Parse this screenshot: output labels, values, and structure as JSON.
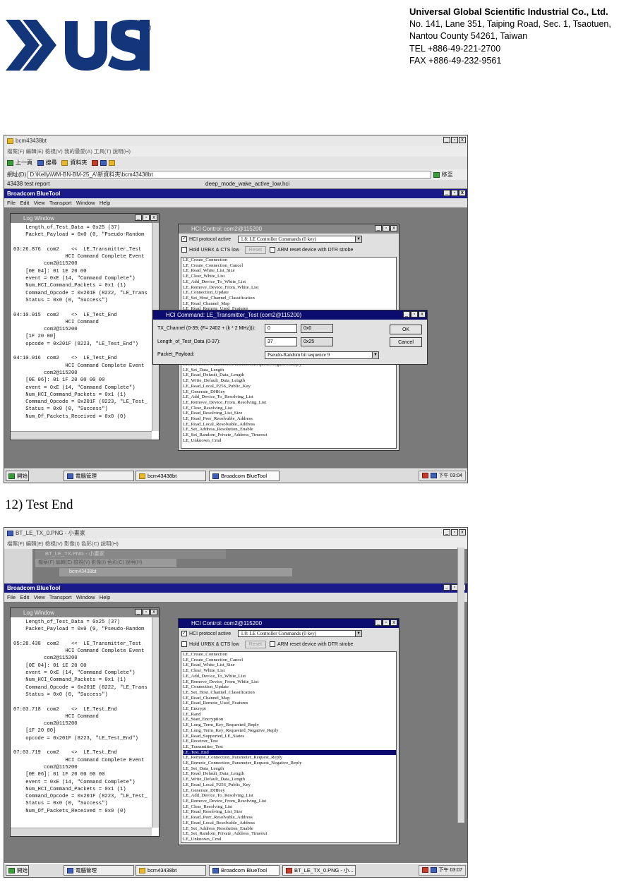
{
  "header": {
    "company_name": "Universal Global Scientific Industrial Co., Ltd.",
    "address_line1": "No. 141, Lane 351, Taiping Road, Sec. 1, Tsaotuen,",
    "address_line2": "Nantou County 54261, Taiwan",
    "tel": "TEL  +886-49-221-2700",
    "fax": "FAX +886-49-232-9561",
    "logo_text": "USI®"
  },
  "caption": "12) Test End",
  "shot1": {
    "explorer_title": "bcm43438bt",
    "explorer_menu": "檔案(F)   編輯(E)   檢視(V)   我的最愛(A)   工具(T)   說明(H)",
    "toolbar_back": "上一頁",
    "toolbar_search": "搜尋",
    "toolbar_folders": "資料夾",
    "address_label": "網址(D)",
    "address_value": "D:\\Kelly\\WM-BN-BM-25_A\\新資料夾\\bcm43438bt",
    "address_go": "移至",
    "tab_left": "43438 test report",
    "tab_right": "deep_mode_wake_active_low.hci",
    "app_title": "Broadcom BlueTool",
    "app_menu": [
      "File",
      "Edit",
      "View",
      "Transport",
      "Window",
      "Help"
    ],
    "log_title": "Log Window",
    "log_lines": [
      "    Length_of_Test_Data = 0x25 (37)",
      "    Packet_Payload = 0x0 (0, \"Pseudo-Random",
      "",
      "03:26.876  com2    <<  LE_Transmitter_Test",
      "                 HCI Command Complete Event",
      "          com2@115200",
      "    [0E 04]: 01 1E 20 00",
      "    event = 0xE (14, \"Command Complete\")",
      "    Num_HCI_Command_Packets = 0x1 (1)",
      "    Command_Opcode = 0x201E (8222, \"LE_Trans",
      "    Status = 0x0 (0, \"Success\")",
      "",
      "04:10.015  com2    <>  LE_Test_End",
      "                 HCI Command",
      "          com2@115200",
      "    [1F 20 00]",
      "    opcode = 0x201F (8223, \"LE_Test_End\")",
      "",
      "04:10.016  com2    <>  LE_Test_End",
      "                 HCI Command Complete Event",
      "          com2@115200",
      "    [0E 06]: 01 1F 20 00 00 00",
      "    event = 0xE (14, \"Command Complete\")",
      "    Num_HCI_Command_Packets = 0x1 (1)",
      "    Command_Opcode = 0x201F (8223, \"LE_Test_",
      "    Status = 0x0 (0, \"Success\")",
      "    Num_Of_Packets_Received = 0x0 (0)"
    ],
    "hci_title": "HCI Control: com2@115200",
    "hci_protocol_label": "HCI protocol active",
    "hci_combo": "1.8: LE Controller Commands (0 key)",
    "hold_label": "Hold URBX & CTS low",
    "reset_label": "Reset",
    "arm_label": "ARM reset device with DTR strobe",
    "cmds_top": [
      "LE_Create_Connection",
      "LE_Create_Connection_Cancel",
      "LE_Read_White_List_Size",
      "LE_Clear_White_List",
      "LE_Add_Device_To_White_List",
      "LE_Remove_Device_From_White_List",
      "LE_Connection_Update",
      "LE_Set_Host_Channel_Classification",
      "LE_Read_Channel_Map",
      "LE_Read_Remote_Used_Features"
    ],
    "cmds_bottom": [
      "LE_Remote_Connection_Parameter_Request_Negative_Reply",
      "LE_Set_Data_Length",
      "LE_Read_Default_Data_Length",
      "LE_Write_Default_Data_Length",
      "LE_Read_Local_P256_Public_Key",
      "LE_Generate_DHKey",
      "LE_Add_Device_To_Resolving_List",
      "LE_Remove_Device_From_Resolving_List",
      "LE_Clear_Resolving_List",
      "LE_Read_Resolving_List_Size",
      "LE_Read_Peer_Resolvable_Address",
      "LE_Read_Local_Resolvable_Address",
      "LE_Set_Address_Resolution_Enable",
      "LE_Set_Random_Private_Address_Timeout",
      "LE_Unknown_Cmd"
    ],
    "dialog_title": "HCI Command: LE_Transmitter_Test (com2@115200)",
    "tx_label": "TX_Channel (0-39; (F= 2402 + (k * 2 MHz))):",
    "tx_value": "0",
    "tx_hex": "0x0",
    "len_label": "Length_of_Test_Data (0-37):",
    "len_value": "37",
    "len_hex": "0x25",
    "payload_label": "Packet_Payload:",
    "payload_value": "Pseudo-Random bit sequence 9",
    "ok_label": "OK",
    "cancel_label": "Cancel",
    "task_start": "開始",
    "task_computer": "電腦管理",
    "task_folder": "bcm43438bt",
    "task_bluetool": "Broadcom BlueTool",
    "clock": "下午 03:04"
  },
  "shot2": {
    "paint_title": "BT_LE_TX_0.PNG - 小畫家",
    "paint_menu": "檔案(F)   編輯(E)   檢視(V)   影像(I)   色彩(C)   說明(H)",
    "paint_inner_title": "BT_LE_TX.PNG - 小畫家",
    "folder_title": "bcm43438bt",
    "app_title": "Broadcom BlueTool",
    "app_menu": [
      "File",
      "Edit",
      "View",
      "Transport",
      "Window",
      "Help"
    ],
    "log_title": "Log Window",
    "log_lines": [
      "    Length_of_Test_Data = 0x25 (37)",
      "    Packet_Payload = 0x0 (0, \"Pseudo-Random",
      "",
      "05:28.438  com2    <<  LE_Transmitter_Test",
      "                 HCI Command Complete Event",
      "          com2@115200",
      "    [0E 04]: 01 1E 20 00",
      "    event = 0xE (14, \"Command Complete\")",
      "    Num_HCI_Command_Packets = 0x1 (1)",
      "    Command_Opcode = 0x201E (8222, \"LE_Trans",
      "    Status = 0x0 (0, \"Success\")",
      "",
      "07:03.718  com2    <>  LE_Test_End",
      "                 HCI Command",
      "          com2@115200",
      "    [1F 20 00]",
      "    opcode = 0x201F (8223, \"LE_Test_End\")",
      "",
      "07:03.719  com2    <>  LE_Test_End",
      "                 HCI Command Complete Event",
      "          com2@115200",
      "    [0E 06]: 01 1F 20 00 00 00",
      "    event = 0xE (14, \"Command Complete\")",
      "    Num_HCI_Command_Packets = 0x1 (1)",
      "    Command_Opcode = 0x201F (8223, \"LE_Test_",
      "    Status = 0x0 (0, \"Success\")",
      "    Num_Of_Packets_Received = 0x0 (0)"
    ],
    "hci_title": "HCI Control: com2@115200",
    "hci_protocol_label": "HCI protocol active",
    "hci_combo": "1.8: LE Controller Commands (0 key)",
    "hold_label": "Hold URBX & CTS low",
    "reset_label": "Reset",
    "arm_label": "ARM reset device with DTR strobe",
    "cmds": [
      "LE_Create_Connection",
      "LE_Create_Connection_Cancel",
      "LE_Read_White_List_Size",
      "LE_Clear_White_List",
      "LE_Add_Device_To_White_List",
      "LE_Remove_Device_From_White_List",
      "LE_Connection_Update",
      "LE_Set_Host_Channel_Classification",
      "LE_Read_Channel_Map",
      "LE_Read_Remote_Used_Features",
      "LE_Encrypt",
      "LE_Rand",
      "LE_Start_Encryption",
      "LE_Long_Term_Key_Requested_Reply",
      "LE_Long_Term_Key_Requested_Negative_Reply",
      "LE_Read_Supported_LE_States",
      "LE_Receiver_Test",
      "LE_Transmitter_Test",
      "LE_Test_End",
      "LE_Remote_Connection_Parameter_Request_Reply",
      "LE_Remote_Connection_Parameter_Request_Negative_Reply",
      "LE_Set_Data_Length",
      "LE_Read_Default_Data_Length",
      "LE_Write_Default_Data_Length",
      "LE_Read_Local_P256_Public_Key",
      "LE_Generate_DHKey",
      "LE_Add_Device_To_Resolving_List",
      "LE_Remove_Device_From_Resolving_List",
      "LE_Clear_Resolving_List",
      "LE_Read_Resolving_List_Size",
      "LE_Read_Peer_Resolvable_Address",
      "LE_Read_Local_Resolvable_Address",
      "LE_Set_Address_Resolution_Enable",
      "LE_Set_Random_Private_Address_Timeout",
      "LE_Unknown_Cmd"
    ],
    "selected_cmd": "LE_Test_End",
    "task_start": "開始",
    "task_computer": "電腦管理",
    "task_folder": "bcm43438bt",
    "task_bluetool": "Broadcom BlueTool",
    "task_paint": "BT_LE_TX_0.PNG - 小...",
    "clock": "下午 03:07"
  }
}
